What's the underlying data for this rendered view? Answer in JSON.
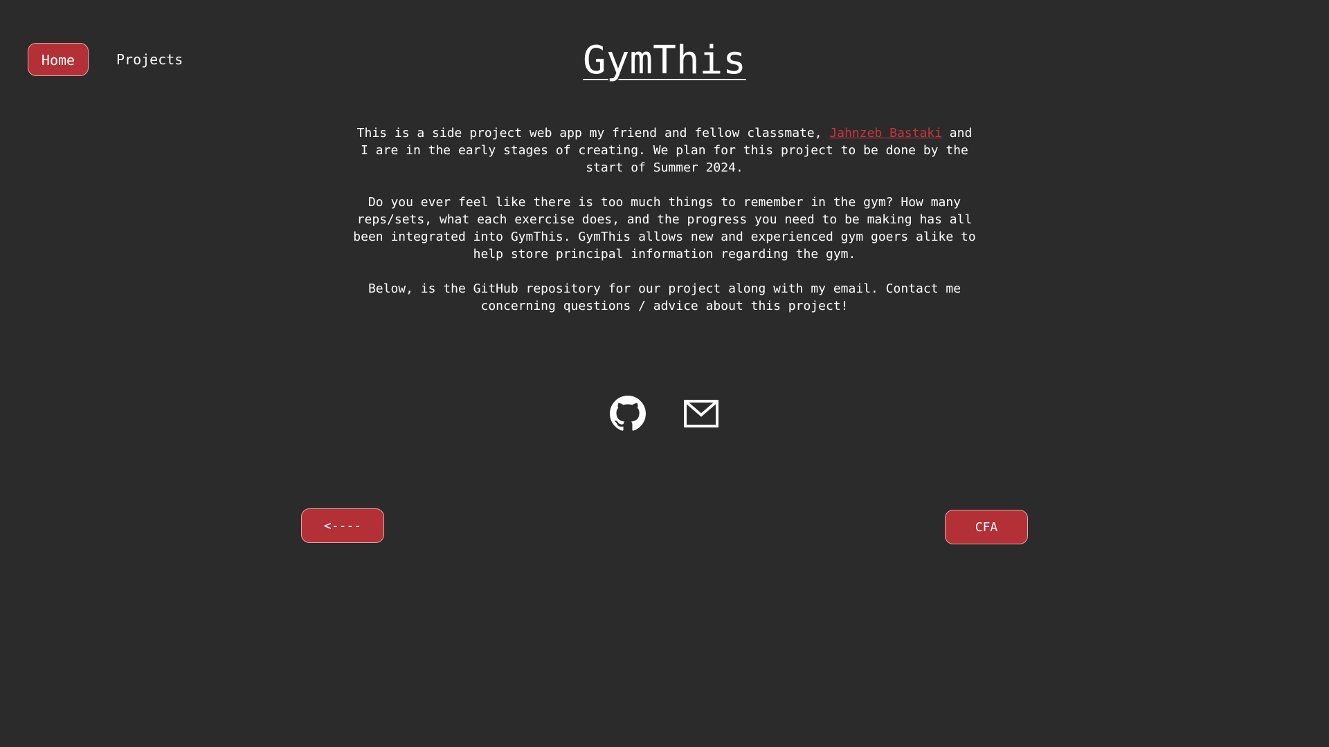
{
  "nav": {
    "home_label": "Home",
    "projects_label": "Projects"
  },
  "page": {
    "title": "GymThis"
  },
  "content": {
    "p1_before": "This is a side project web app my friend and fellow classmate, ",
    "p1_link": "Jahnzeb Bastaki",
    "p1_after": " and I are in the early stages of creating. We plan for this project to be done by the start of Summer 2024.",
    "p2": "Do you ever feel like there is too much things to remember in the gym? How many reps/sets, what each exercise does, and the progress you need to be making has all been integrated into GymThis. GymThis allows new and experienced gym goers alike to help store principal information regarding the gym.",
    "p3": "Below, is the GitHub repository for our project along with my email. Contact me concerning questions / advice about this project!"
  },
  "icons": {
    "github": "github-icon",
    "email": "mail-icon"
  },
  "buttons": {
    "back_label": "<----",
    "next_label": "CFA"
  },
  "colors": {
    "background": "#2b2b2b",
    "accent": "#b23036",
    "link": "#c9353c",
    "text": "#ffffff"
  }
}
